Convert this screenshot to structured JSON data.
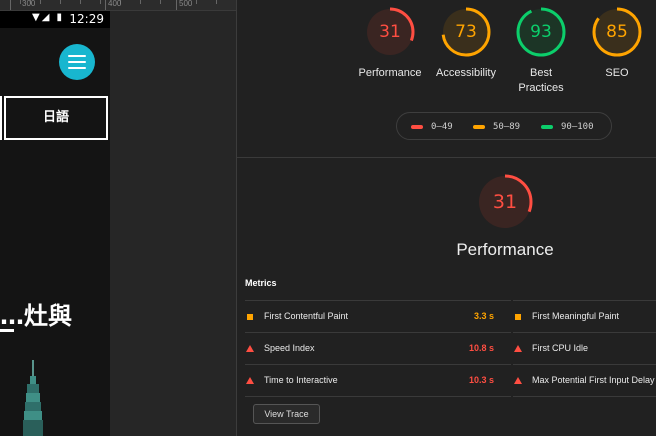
{
  "device": {
    "status_time": "12:29",
    "status_icons": "▼◢ ▮",
    "lang_button": "日語",
    "hero_text": "…灶與"
  },
  "ruler": {
    "labels": [
      "300",
      "400",
      "500"
    ]
  },
  "colors": {
    "fail": "#ff4e42",
    "average": "#ffa400",
    "pass": "#0cce6b"
  },
  "scores": [
    {
      "label": "Performance",
      "value": "31",
      "level": "fail"
    },
    {
      "label": "Accessibility",
      "value": "73",
      "level": "average"
    },
    {
      "label": "Best Practices",
      "value": "93",
      "level": "pass"
    },
    {
      "label": "SEO",
      "value": "85",
      "level": "average"
    }
  ],
  "legend": [
    {
      "range": "0–49",
      "level": "fail"
    },
    {
      "range": "50–89",
      "level": "average"
    },
    {
      "range": "90–100",
      "level": "pass"
    }
  ],
  "performance": {
    "score": "31",
    "title": "Performance",
    "metrics_heading": "Metrics",
    "metrics_left": [
      {
        "name": "First Contentful Paint",
        "value": "3.3 s",
        "level": "average",
        "icon": "square-icon"
      },
      {
        "name": "Speed Index",
        "value": "10.8 s",
        "level": "fail",
        "icon": "triangle-icon"
      },
      {
        "name": "Time to Interactive",
        "value": "10.3 s",
        "level": "fail",
        "icon": "triangle-icon"
      }
    ],
    "metrics_right": [
      {
        "name": "First Meaningful Paint",
        "level": "average",
        "icon": "square-icon"
      },
      {
        "name": "First CPU Idle",
        "level": "fail",
        "icon": "triangle-icon"
      },
      {
        "name": "Max Potential First Input Delay",
        "level": "fail",
        "icon": "triangle-icon"
      }
    ],
    "view_trace": "View Trace"
  }
}
